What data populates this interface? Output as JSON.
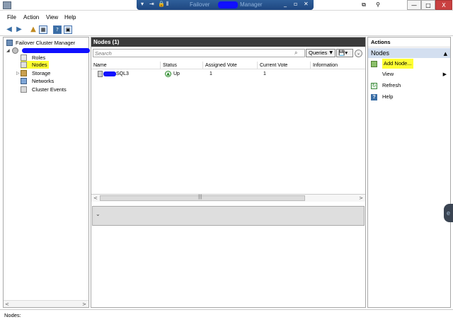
{
  "rdp_bar": {
    "pin_icon": "pin-icon",
    "signal_icon": "signal-icon",
    "lock_icon": "lock-icon",
    "title_prefix": "Failover",
    "title_suffix": "Manager",
    "minimize": "_",
    "restore": "▫",
    "close": "✕"
  },
  "window_buttons": {
    "restore": "⧉",
    "pin": "⚲",
    "minimize": "—",
    "maximize": "□",
    "close": "X"
  },
  "menu": [
    "File",
    "Action",
    "View",
    "Help"
  ],
  "toolbar": {
    "back": "◀",
    "forward": "▶",
    "up": "▲",
    "show_hide": "▦",
    "help": "?",
    "properties": "▣"
  },
  "tree": {
    "root": "Failover Cluster Manager",
    "items": [
      {
        "label": "Roles"
      },
      {
        "label": "Nodes"
      },
      {
        "label": "Storage"
      },
      {
        "label": "Networks"
      },
      {
        "label": "Cluster Events"
      }
    ]
  },
  "middle": {
    "title": "Nodes (1)",
    "search_placeholder": "Search",
    "queries_label": "Queries",
    "save_glyph": "💾▾",
    "expand_glyph": "⌄",
    "columns": [
      "Name",
      "Status",
      "Assigned Vote",
      "Current Vote",
      "Information"
    ],
    "rows": [
      {
        "name_suffix": "SQL3",
        "status": "Up",
        "assigned_vote": "1",
        "current_vote": "1",
        "information": ""
      }
    ]
  },
  "actions": {
    "title": "Actions",
    "group": "Nodes",
    "items": [
      {
        "label": "Add Node..."
      },
      {
        "label": "View"
      },
      {
        "label": "Refresh"
      },
      {
        "label": "Help"
      }
    ]
  },
  "status_bar": {
    "text": "Nodes:"
  },
  "colors": {
    "highlight": "#ffff33",
    "redaction": "#1010ff",
    "header_dark": "#3a3a3a",
    "actions_group": "#d3dff0",
    "status_up": "#2e8b2e"
  }
}
